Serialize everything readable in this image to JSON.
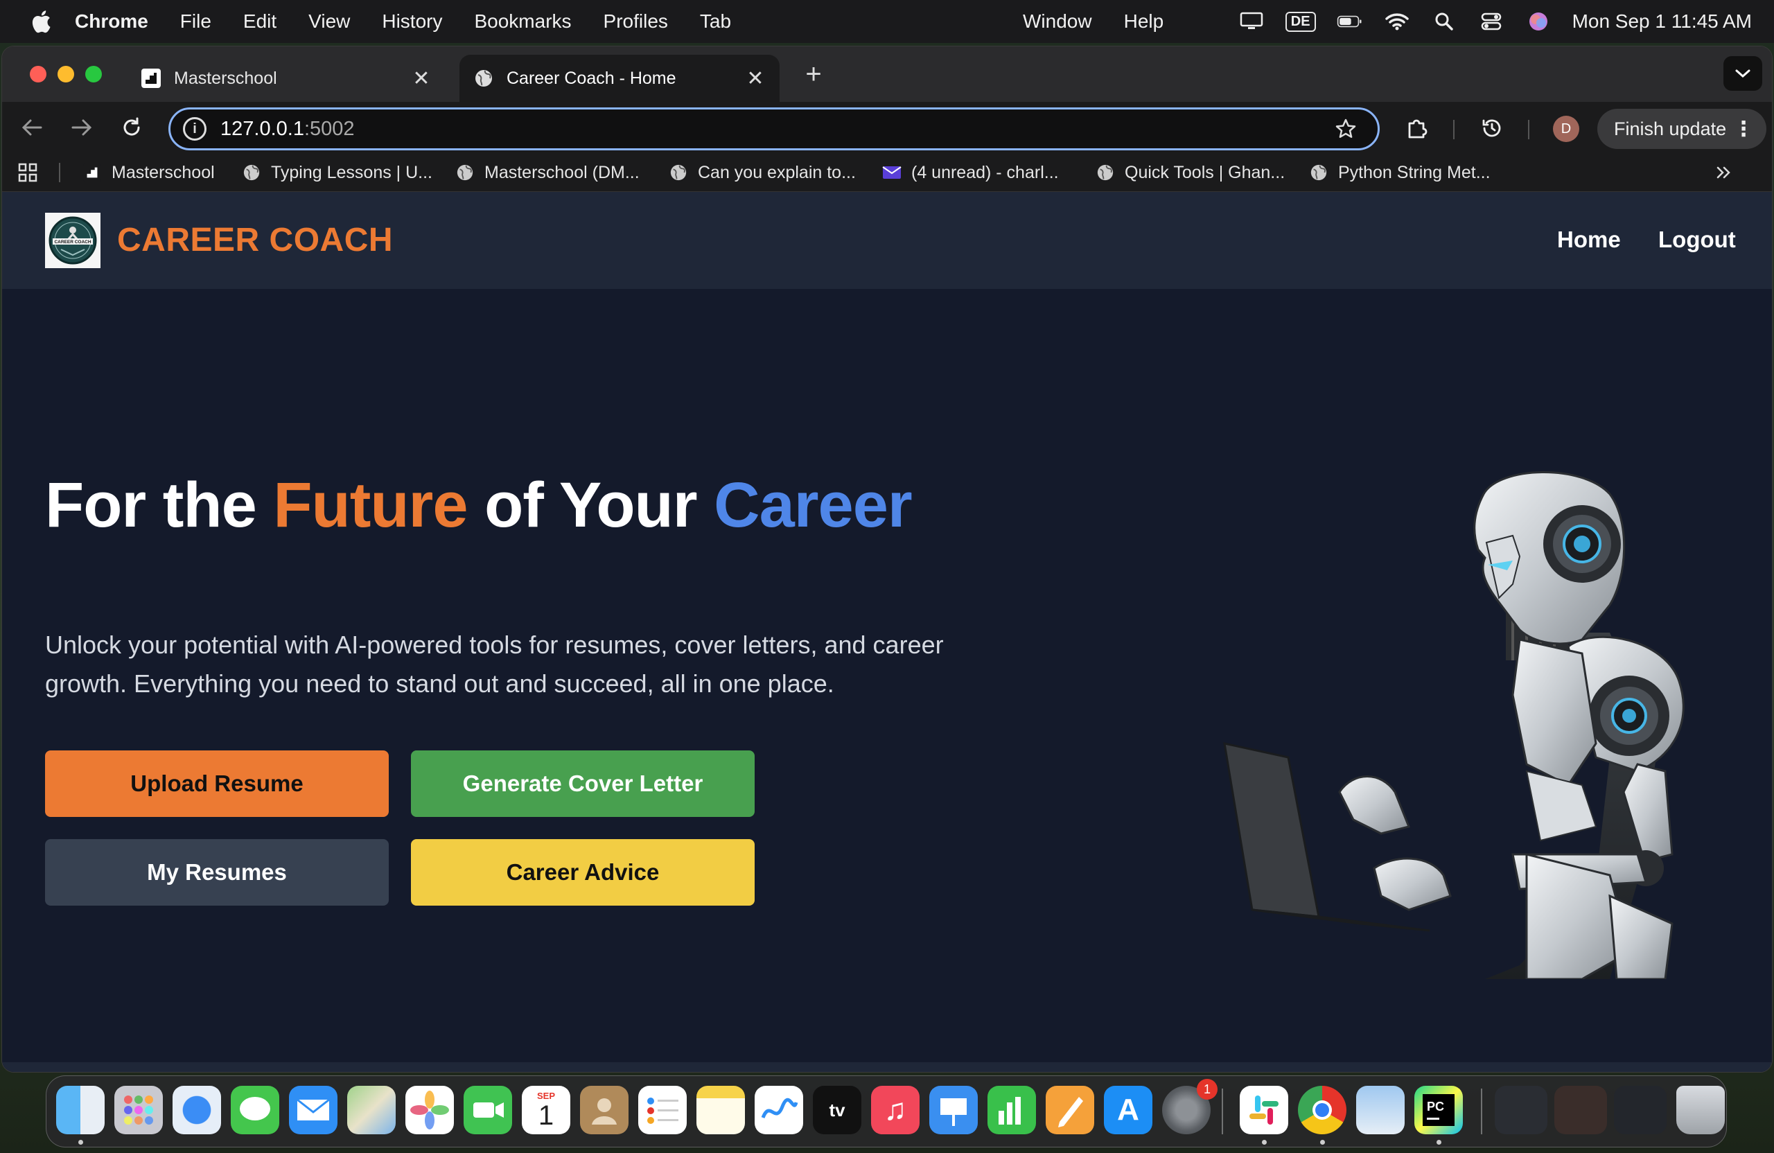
{
  "menubar": {
    "app_name": "Chrome",
    "menus": [
      "File",
      "Edit",
      "View",
      "History",
      "Bookmarks",
      "Profiles",
      "Tab"
    ],
    "menus_right": [
      "Window",
      "Help"
    ],
    "keyboard_layout": "DE",
    "datetime": "Mon Sep 1  11:45 AM"
  },
  "tabs": [
    {
      "title": "Masterschool",
      "icon": "masterschool-icon",
      "active": false
    },
    {
      "title": "Career Coach - Home",
      "icon": "globe-icon",
      "active": true
    }
  ],
  "toolbar": {
    "url_host": "127.0.0.1",
    "url_port": ":5002",
    "profile_initial": "D",
    "finish_update_label": "Finish update"
  },
  "bookmarks": [
    {
      "label": "Masterschool",
      "icon": "masterschool-icon"
    },
    {
      "label": "Typing Lessons | U...",
      "icon": "globe-icon"
    },
    {
      "label": "Masterschool (DM...",
      "icon": "globe-icon"
    },
    {
      "label": "Can you explain to...",
      "icon": "globe-icon"
    },
    {
      "label": "(4 unread) - charl...",
      "icon": "mail-icon"
    },
    {
      "label": "Quick Tools | Ghan...",
      "icon": "globe-icon"
    },
    {
      "label": "Python String Met...",
      "icon": "globe-icon"
    }
  ],
  "site": {
    "brand": "CAREER COACH",
    "logo_text": "CAREER COACH",
    "nav": [
      "Home",
      "Logout"
    ],
    "hero": {
      "title_part1": "For the ",
      "title_orange": "Future",
      "title_part2": " of Your ",
      "title_blue": "Career",
      "subtitle": "Unlock your potential with AI-powered tools for resumes, cover letters, and career growth. Everything you need to stand out and succeed, all in one place."
    },
    "buttons": {
      "upload": "Upload Resume",
      "cover": "Generate Cover Letter",
      "resumes": "My Resumes",
      "advice": "Career Advice"
    }
  },
  "dock": {
    "calendar_month": "SEP",
    "calendar_day": "1",
    "settings_badge": "1",
    "apps": [
      "finder",
      "launchpad",
      "safari",
      "messages",
      "mail",
      "maps",
      "photos",
      "facetime",
      "calendar",
      "contacts",
      "reminders",
      "notes",
      "freeform",
      "tv",
      "music",
      "keynote",
      "numbers",
      "pages",
      "app-store",
      "system-settings",
      "slack",
      "chrome",
      "preview",
      "pycharm",
      "trash"
    ]
  },
  "colors": {
    "accent_orange": "#ec7a33",
    "accent_blue": "#4f86e8",
    "accent_green": "#48a04f",
    "accent_yellow": "#f2cd44",
    "page_bg": "#141a2b",
    "header_bg": "#1f2738"
  }
}
